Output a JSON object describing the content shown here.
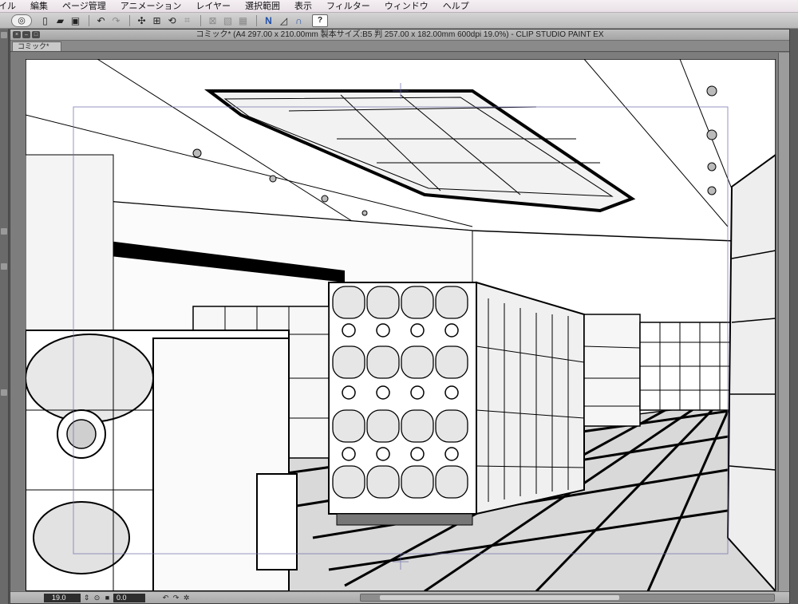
{
  "menubar": {
    "items": [
      "イル",
      "編集",
      "ページ管理",
      "アニメーション",
      "レイヤー",
      "選択範囲",
      "表示",
      "フィルター",
      "ウィンドウ",
      "ヘルプ"
    ]
  },
  "toolbar": {
    "icons": [
      "app-logo",
      "new-file",
      "open-file",
      "save-file",
      "undo",
      "redo",
      "selection-move",
      "transform",
      "rotate",
      "clear",
      "fill",
      "grid",
      "ruler-link",
      "ruler-snap",
      "perspective-snap",
      "help"
    ],
    "help_label": "?"
  },
  "window": {
    "title": "コミック* (A4 297.00 x 210.00mm 製本サイズ:B5 判 257.00 x 182.00mm 600dpi 19.0%)  - CLIP STUDIO PAINT EX",
    "tab_label": "コミック*"
  },
  "status": {
    "zoom": "19.0",
    "angle": "0.0"
  },
  "colors": {
    "menubar_bg": "#efe8ed",
    "toolbar_bg": "#c6c6c6",
    "window_bg": "#7a7a7a",
    "paper": "#ffffff",
    "ink": "#000000",
    "screentone": "#c8c8c8"
  }
}
